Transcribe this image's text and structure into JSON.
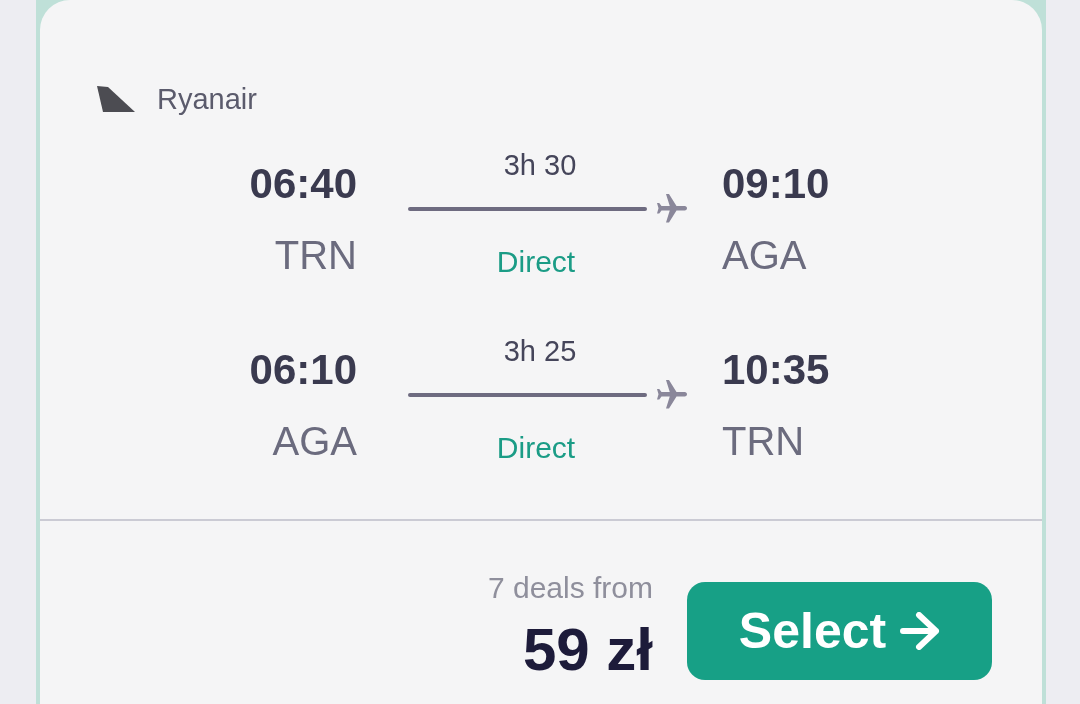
{
  "airline": {
    "name": "Ryanair"
  },
  "legs": [
    {
      "departure_time": "06:40",
      "departure_airport": "TRN",
      "duration": "3h 30",
      "stops": "Direct",
      "arrival_time": "09:10",
      "arrival_airport": "AGA"
    },
    {
      "departure_time": "06:10",
      "departure_airport": "AGA",
      "duration": "3h 25",
      "stops": "Direct",
      "arrival_time": "10:35",
      "arrival_airport": "TRN"
    }
  ],
  "offer": {
    "deals": "7 deals from",
    "price": "59 zł"
  },
  "select_button": {
    "label": "Select"
  }
}
